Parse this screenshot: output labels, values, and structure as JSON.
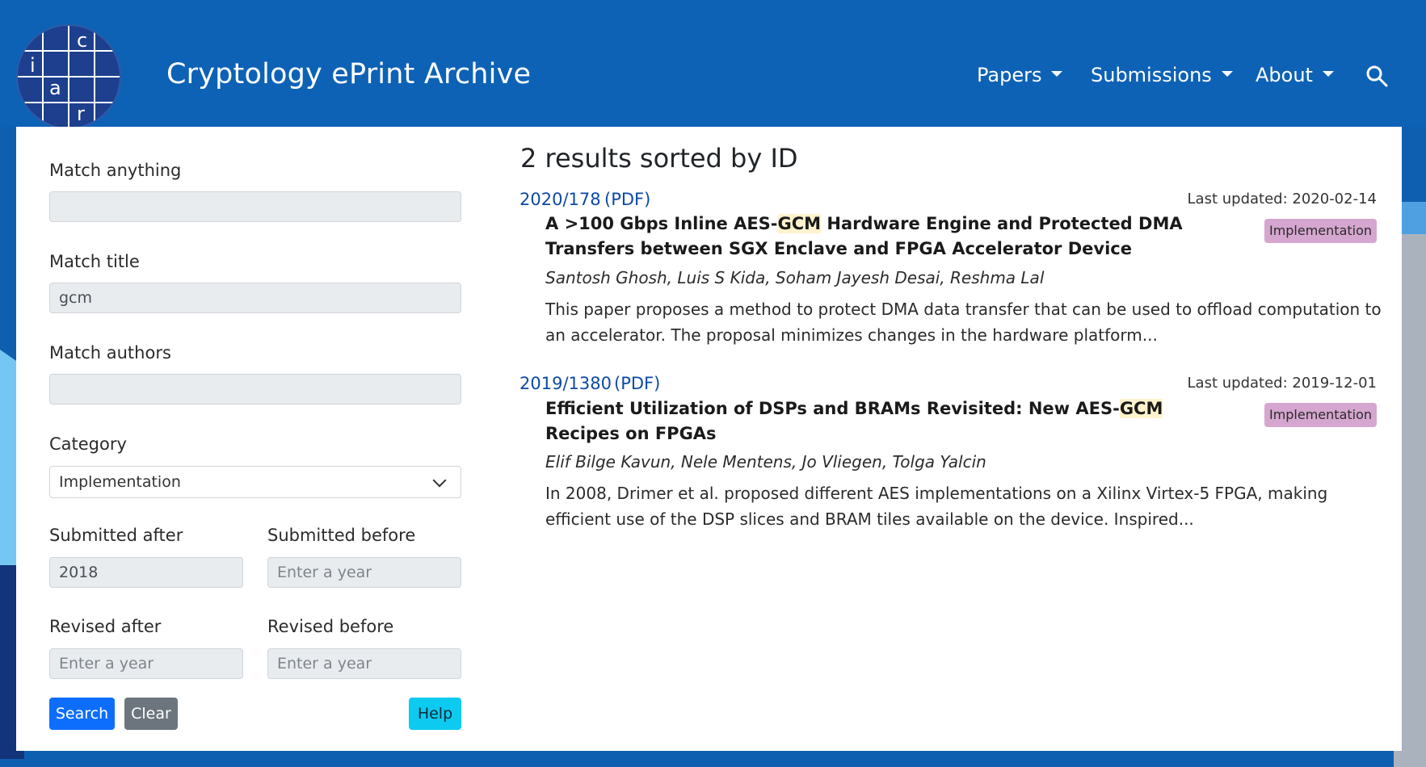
{
  "header": {
    "logo_letters": [
      "c",
      "i",
      "a",
      "r"
    ],
    "brand": "Cryptology ePrint Archive",
    "nav": [
      "Papers",
      "Submissions",
      "About"
    ]
  },
  "form": {
    "match_anything_label": "Match anything",
    "match_anything_value": "",
    "match_title_label": "Match title",
    "match_title_value": "gcm",
    "match_authors_label": "Match authors",
    "match_authors_value": "",
    "category_label": "Category",
    "category_value": "Implementation",
    "submitted_after_label": "Submitted after",
    "submitted_after_value": "2018",
    "submitted_before_label": "Submitted before",
    "submitted_before_placeholder": "Enter a year",
    "revised_after_label": "Revised after",
    "revised_after_placeholder": "Enter a year",
    "revised_before_label": "Revised before",
    "revised_before_placeholder": "Enter a year",
    "search_button": "Search",
    "clear_button": "Clear",
    "help_button": "Help"
  },
  "results": {
    "heading": "2 results sorted by ID",
    "items": [
      {
        "id": "2020/178",
        "pdf": "(PDF)",
        "updated": "Last updated: 2020-02-14",
        "title_pre": "A >100 Gbps Inline AES-",
        "title_hl": "GCM",
        "title_post": " Hardware Engine and Protected DMA Transfers between SGX Enclave and FPGA Accelerator Device",
        "badge": "Implementation",
        "authors": "Santosh Ghosh, Luis S Kida, Soham Jayesh Desai, Reshma Lal",
        "abstract": "This paper proposes a method to protect DMA data transfer that can be used to offload computation to an accelerator. The proposal minimizes changes in the hardware platform..."
      },
      {
        "id": "2019/1380",
        "pdf": "(PDF)",
        "updated": "Last updated: 2019-12-01",
        "title_pre": "Efficient Utilization of DSPs and BRAMs Revisited: New AES-",
        "title_hl": "GCM",
        "title_post": " Recipes on FPGAs",
        "badge": "Implementation",
        "authors": "Elif Bilge Kavun, Nele Mentens, Jo Vliegen, Tolga Yalcin",
        "abstract": "In 2008, Drimer et al. proposed different AES implementations on a Xilinx Virtex-5 FPGA, making efficient use of the DSP slices and BRAM tiles available on the device. Inspired..."
      }
    ]
  },
  "colors": {
    "navbar": "#0d62b6",
    "link": "#0d4aa6",
    "badge": "#d5a6cf",
    "search_button": "#0d6efd",
    "clear_button": "#6c757d",
    "help_button": "#0dcaf0"
  }
}
